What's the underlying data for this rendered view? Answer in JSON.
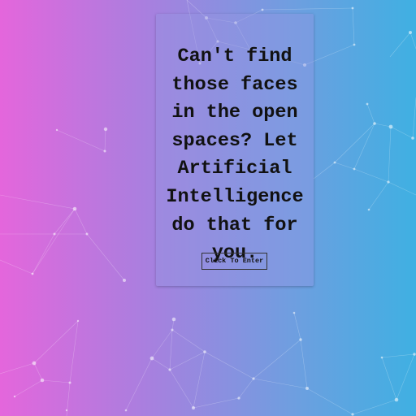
{
  "hero": {
    "headline": "Can't find those faces in the open spaces? Let Artificial Intelligence do that for you.",
    "enter_button_label": "Click To Enter"
  },
  "theme": {
    "gradient_left": "#e466dc",
    "gradient_right": "#3fb0e2",
    "text_color": "#111111"
  }
}
